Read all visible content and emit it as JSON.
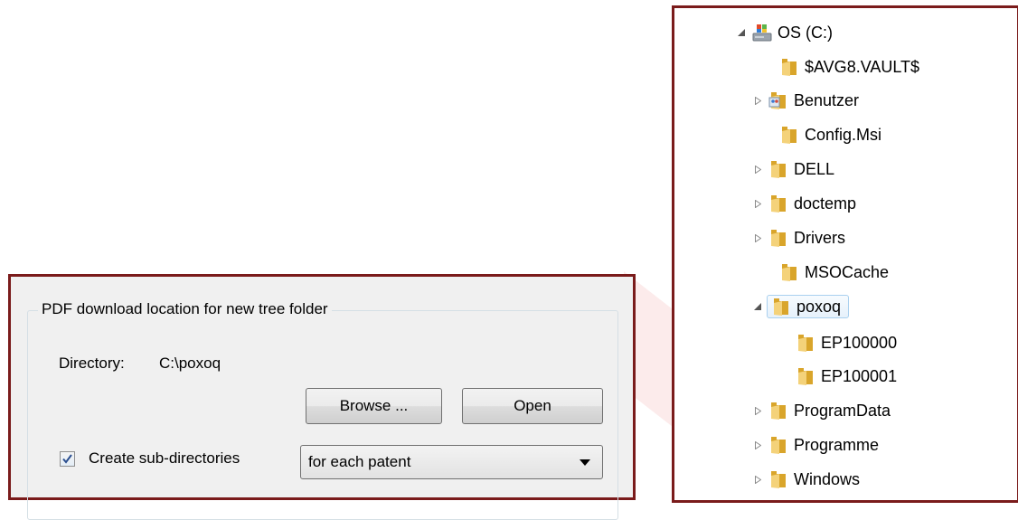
{
  "dialog": {
    "group_title": "PDF download location for new tree folder",
    "directory_label": "Directory:",
    "directory_value": "C:\\poxoq",
    "browse_label": "Browse ...",
    "open_label": "Open",
    "create_subdirs_label": "Create sub-directories",
    "create_subdirs_checked": true,
    "subdir_option": "for each patent"
  },
  "tree": {
    "drive_label": "OS (C:)",
    "items": [
      {
        "label": "$AVG8.VAULT$"
      },
      {
        "label": "Benutzer"
      },
      {
        "label": "Config.Msi"
      },
      {
        "label": "DELL"
      },
      {
        "label": "doctemp"
      },
      {
        "label": "Drivers"
      },
      {
        "label": "MSOCache"
      },
      {
        "label": "poxoq"
      },
      {
        "label": "EP100000"
      },
      {
        "label": "EP100001"
      },
      {
        "label": "ProgramData"
      },
      {
        "label": "Programme"
      },
      {
        "label": "Windows"
      }
    ]
  },
  "colors": {
    "frame": "#7a1b1b",
    "folder": "#e8b83a",
    "selection": "#cde8fb"
  }
}
